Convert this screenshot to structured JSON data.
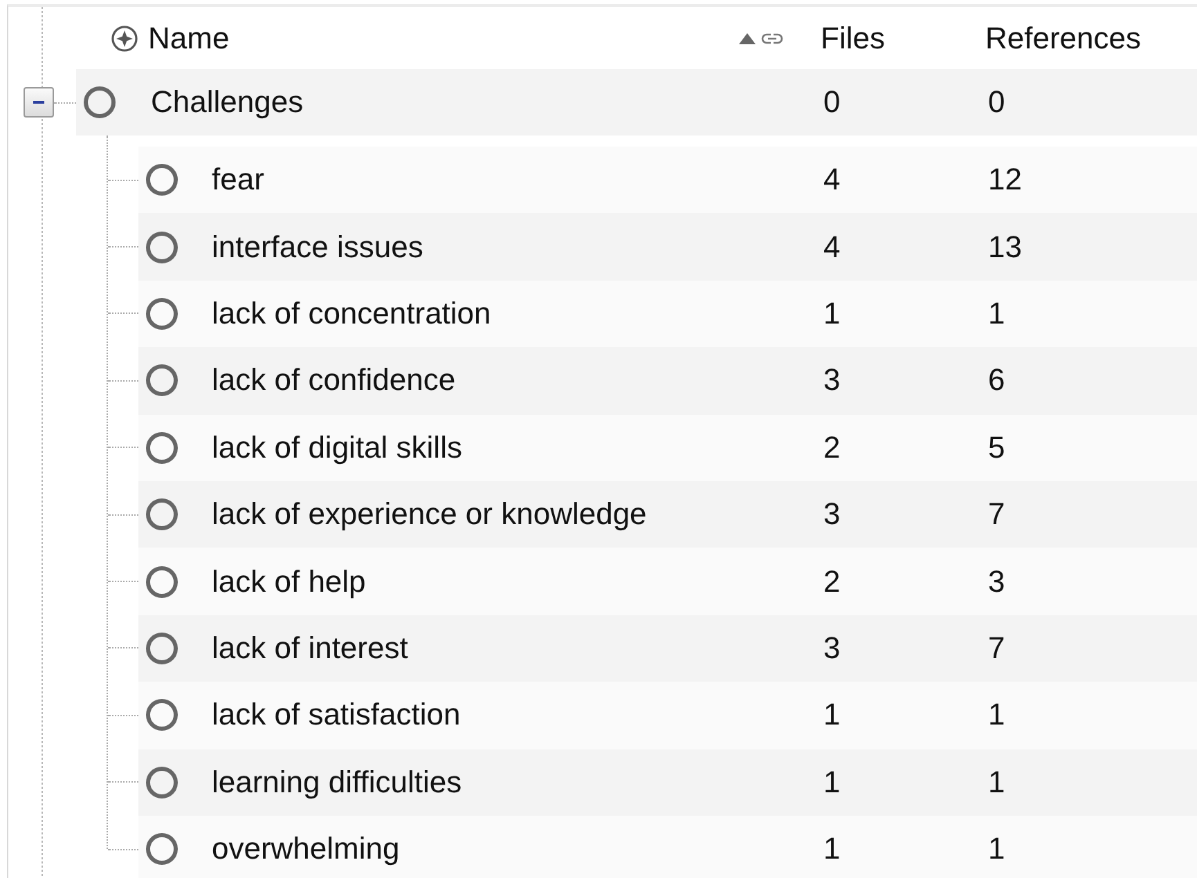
{
  "columns": [
    {
      "label": "Name",
      "sorted": true
    },
    {
      "label": "Files",
      "sorted": false
    },
    {
      "label": "References",
      "sorted": false
    }
  ],
  "tree": [
    {
      "name": "Challenges",
      "files": "0",
      "references": "0",
      "expanded": true,
      "children": [
        {
          "name": "fear",
          "files": "4",
          "references": "12"
        },
        {
          "name": "interface issues",
          "files": "4",
          "references": "13"
        },
        {
          "name": "lack of concentration",
          "files": "1",
          "references": "1"
        },
        {
          "name": "lack of confidence",
          "files": "3",
          "references": "6"
        },
        {
          "name": "lack of digital skills",
          "files": "2",
          "references": "5"
        },
        {
          "name": "lack of experience or knowledge",
          "files": "3",
          "references": "7"
        },
        {
          "name": "lack of help",
          "files": "2",
          "references": "3"
        },
        {
          "name": "lack of interest",
          "files": "3",
          "references": "7"
        },
        {
          "name": "lack of satisfaction",
          "files": "1",
          "references": "1"
        },
        {
          "name": "learning difficulties",
          "files": "1",
          "references": "1"
        },
        {
          "name": "overwhelming",
          "files": "1",
          "references": "1"
        }
      ]
    }
  ]
}
